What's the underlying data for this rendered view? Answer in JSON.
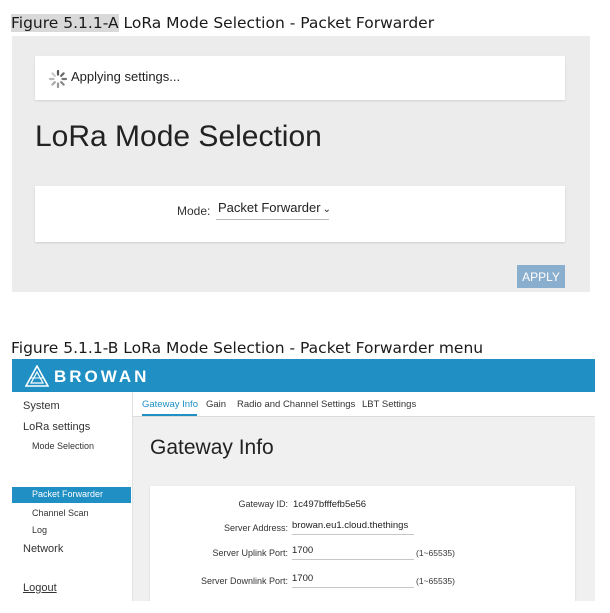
{
  "figure_a": {
    "caption_prefix": "Figure 5.1.1-A",
    "caption_rest": " LoRa Mode Selection - Packet Forwarder",
    "status": {
      "text": "Applying settings...",
      "icon": "spinner-icon"
    },
    "title": "LoRa Mode Selection",
    "mode": {
      "label": "Mode:",
      "value": "Packet Forwarder",
      "icon": "chevron-down-icon"
    },
    "apply_label": "APPLY"
  },
  "figure_b": {
    "caption": "Figure 5.1.1-B LoRa Mode Selection - Packet Forwarder menu",
    "brand": {
      "name": "BROWAN",
      "logo_icon": "browan-logo-icon"
    },
    "sidebar": {
      "system": "System",
      "lora_settings": "LoRa settings",
      "mode_selection": "Mode Selection",
      "packet_forwarder": "Packet Forwarder",
      "channel_scan": "Channel Scan",
      "log": "Log",
      "network": "Network",
      "logout": "Logout"
    },
    "tabs": {
      "gateway_info": "Gateway Info",
      "gain": "Gain",
      "radio_channel": "Radio and Channel Settings",
      "lbt": "LBT Settings"
    },
    "title": "Gateway Info",
    "fields": {
      "gateway_id_label": "Gateway ID:",
      "gateway_id_value": "1c497bfffefb5e56",
      "server_address_label": "Server Address:",
      "server_address_value": "browan.eu1.cloud.thethings",
      "uplink_label": "Server Uplink Port:",
      "uplink_value": "1700",
      "uplink_range": "(1~65535)",
      "downlink_label": "Server Downlink Port:",
      "downlink_value": "1700",
      "downlink_range": "(1~65535)"
    }
  },
  "colors": {
    "brand_blue": "#1f8fc4",
    "apply_button": "#8aaecd",
    "panel_bg": "#ececec"
  }
}
